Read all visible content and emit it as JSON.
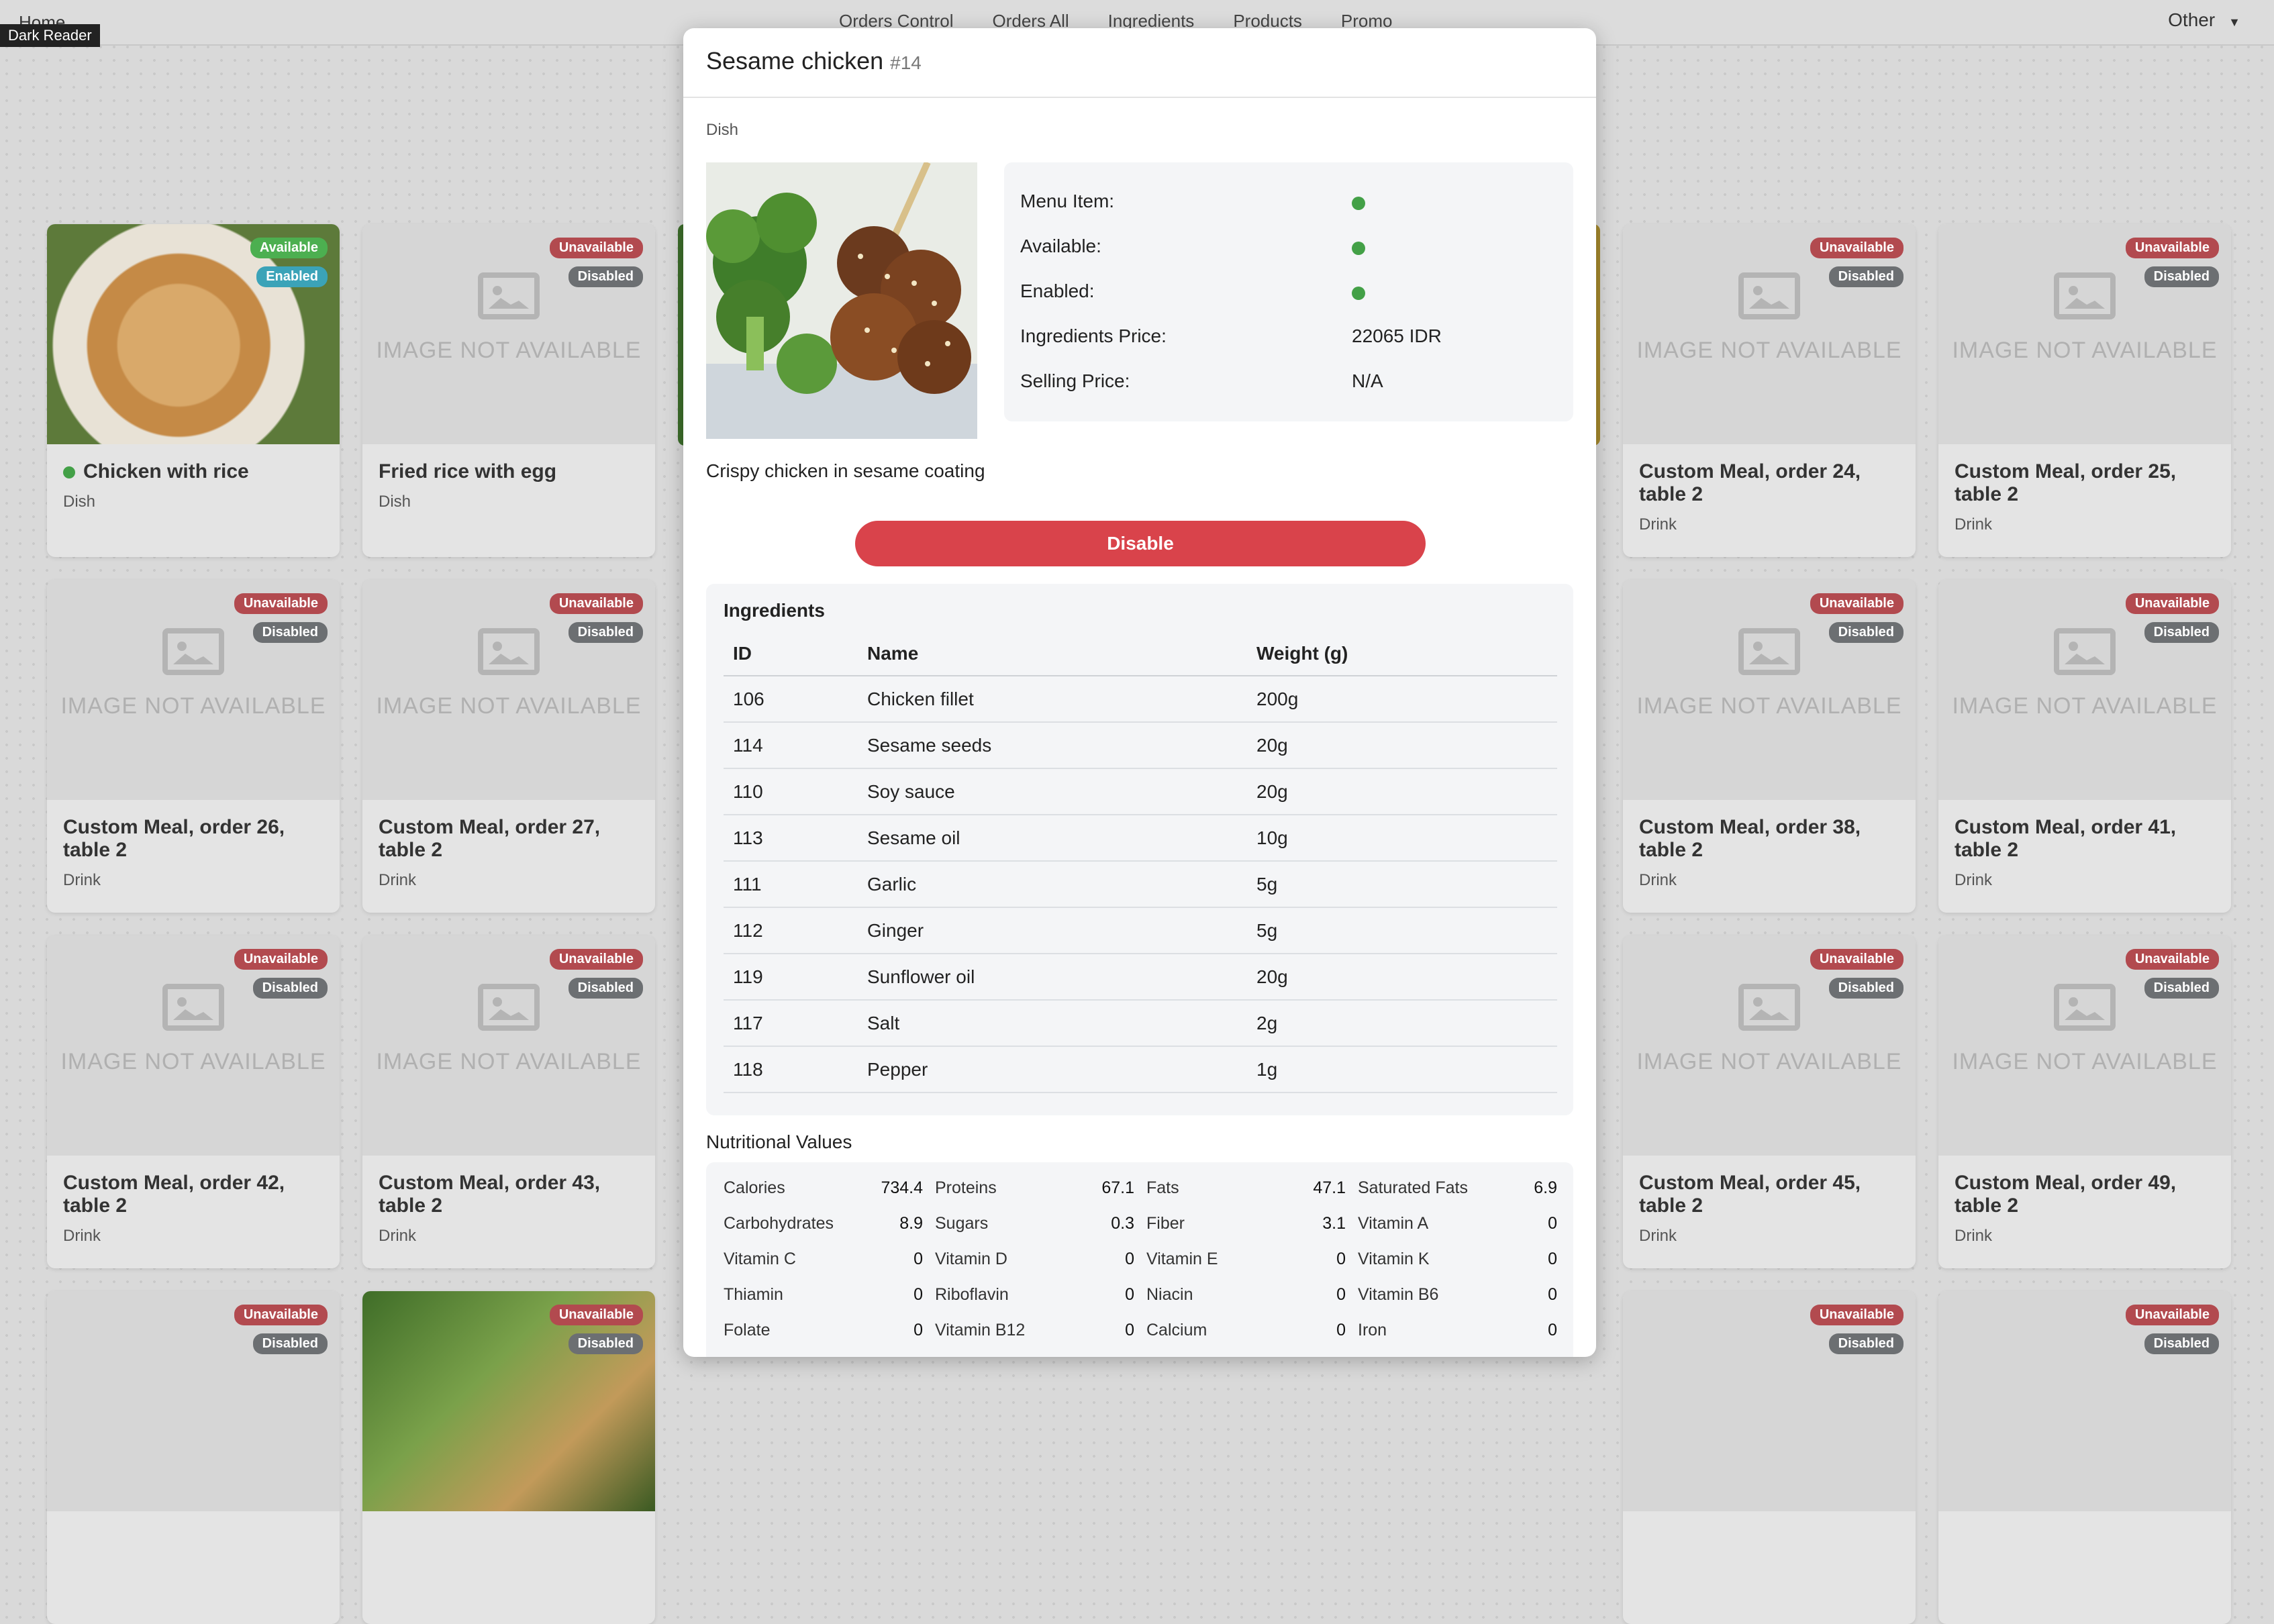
{
  "navbar": {
    "home": "Home",
    "dark_reader": "Dark Reader",
    "links": [
      "Orders Control",
      "Orders All",
      "Ingredients",
      "Products",
      "Promo"
    ],
    "other": "Other"
  },
  "grid": {
    "no_image_text": "IMAGE NOT AVAILABLE",
    "badge_unavailable": "Unavailable",
    "badge_disabled": "Disabled",
    "badge_available": "Available",
    "badge_enabled": "Enabled",
    "cards": [
      {
        "title": "Chicken with rice",
        "category": "Dish"
      },
      {
        "title": "Fried rice with egg",
        "category": "Dish"
      },
      {
        "title": "Custom Meal, order 24, table 2",
        "category": "Drink"
      },
      {
        "title": "Custom Meal, order 25, table 2",
        "category": "Drink"
      },
      {
        "title": "Custom Meal, order 26, table 2",
        "category": "Drink"
      },
      {
        "title": "Custom Meal, order 27, table 2",
        "category": "Drink"
      },
      {
        "title": "Custom Meal, order 38, table 2",
        "category": "Drink"
      },
      {
        "title": "Custom Meal, order 41, table 2",
        "category": "Drink"
      },
      {
        "title": "Custom Meal, order 42, table 2",
        "category": "Drink"
      },
      {
        "title": "Custom Meal, order 43, table 2",
        "category": "Drink"
      },
      {
        "title": "Custom Meal, order 45, table 2",
        "category": "Drink"
      },
      {
        "title": "Custom Meal, order 49, table 2",
        "category": "Drink"
      }
    ]
  },
  "modal": {
    "title": "Sesame chicken",
    "id": "#14",
    "category": "Dish",
    "info": {
      "menu_item_label": "Menu Item:",
      "available_label": "Available:",
      "enabled_label": "Enabled:",
      "ingredients_price_label": "Ingredients Price:",
      "ingredients_price_value": "22065 IDR",
      "selling_price_label": "Selling Price:",
      "selling_price_value": "N/A"
    },
    "description": "Crispy chicken in sesame coating",
    "disable_button": "Disable",
    "ingredients": {
      "title": "Ingredients",
      "headers": [
        "ID",
        "Name",
        "Weight (g)"
      ],
      "rows": [
        [
          "106",
          "Chicken fillet",
          "200g"
        ],
        [
          "114",
          "Sesame seeds",
          "20g"
        ],
        [
          "110",
          "Soy sauce",
          "20g"
        ],
        [
          "113",
          "Sesame oil",
          "10g"
        ],
        [
          "111",
          "Garlic",
          "5g"
        ],
        [
          "112",
          "Ginger",
          "5g"
        ],
        [
          "119",
          "Sunflower oil",
          "20g"
        ],
        [
          "117",
          "Salt",
          "2g"
        ],
        [
          "118",
          "Pepper",
          "1g"
        ]
      ]
    },
    "nutrition": {
      "title": "Nutritional Values",
      "items": [
        {
          "label": "Calories",
          "value": "734.4"
        },
        {
          "label": "Proteins",
          "value": "67.1"
        },
        {
          "label": "Fats",
          "value": "47.1"
        },
        {
          "label": "Saturated Fats",
          "value": "6.9"
        },
        {
          "label": "Carbohydrates",
          "value": "8.9"
        },
        {
          "label": "Sugars",
          "value": "0.3"
        },
        {
          "label": "Fiber",
          "value": "3.1"
        },
        {
          "label": "Vitamin A",
          "value": "0"
        },
        {
          "label": "Vitamin C",
          "value": "0"
        },
        {
          "label": "Vitamin D",
          "value": "0"
        },
        {
          "label": "Vitamin E",
          "value": "0"
        },
        {
          "label": "Vitamin K",
          "value": "0"
        },
        {
          "label": "Thiamin",
          "value": "0"
        },
        {
          "label": "Riboflavin",
          "value": "0"
        },
        {
          "label": "Niacin",
          "value": "0"
        },
        {
          "label": "Vitamin B6",
          "value": "0"
        },
        {
          "label": "Folate",
          "value": "0"
        },
        {
          "label": "Vitamin B12",
          "value": "0"
        },
        {
          "label": "Calcium",
          "value": "0"
        },
        {
          "label": "Iron",
          "value": "0"
        }
      ]
    }
  }
}
